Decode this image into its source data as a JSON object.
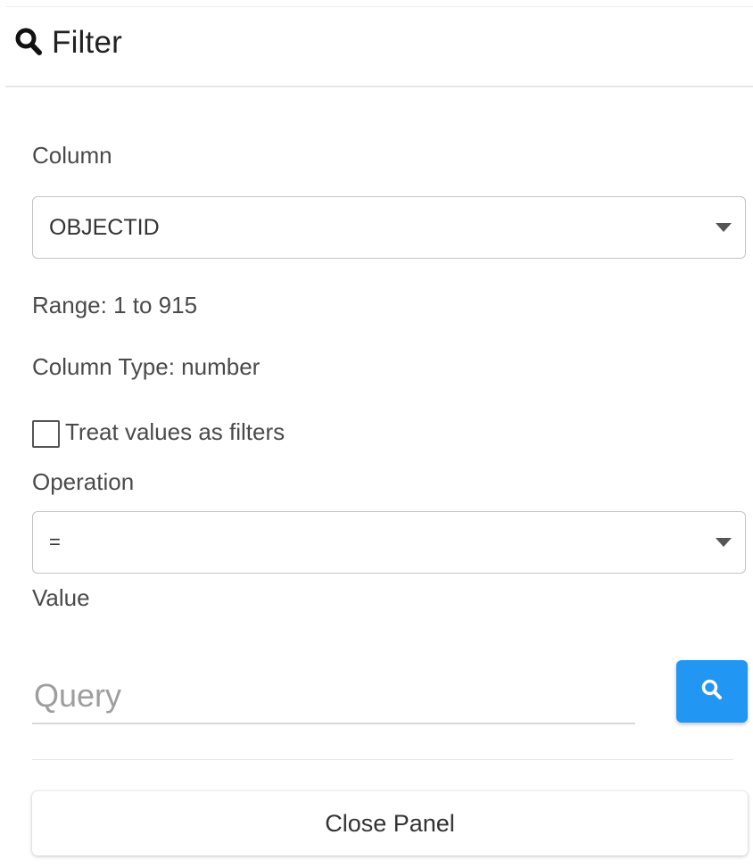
{
  "panel": {
    "title": "Filter",
    "icon": "search-icon"
  },
  "column": {
    "label": "Column",
    "selected": "OBJECTID"
  },
  "range_text": "Range: 1 to 915",
  "column_type_text": "Column Type: number",
  "treat_values": {
    "label": "Treat values as filters",
    "checked": false
  },
  "operation": {
    "label": "Operation",
    "selected": "="
  },
  "value": {
    "label": "Value",
    "placeholder": "Query",
    "current": ""
  },
  "search_button": {
    "icon": "search-icon",
    "color": "#2196f3"
  },
  "close_button": {
    "label": "Close Panel"
  }
}
